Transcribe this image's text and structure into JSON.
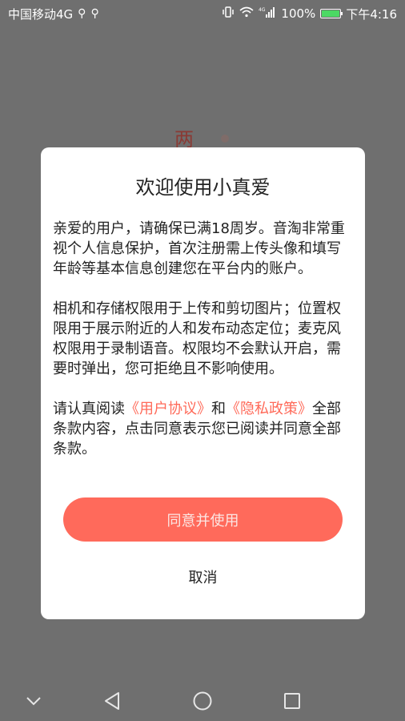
{
  "status_bar": {
    "carrier": "中国移动4G",
    "network": "4G",
    "battery_percent": "100%",
    "time": "下午4:16",
    "battery_level": 1.0,
    "colors": {
      "battery_fill": "#4cd964"
    }
  },
  "background": {
    "partial_char": "两"
  },
  "dialog": {
    "title": "欢迎使用小真爱",
    "paragraph1": "亲爱的用户，请确保已满18周岁。音淘非常重视个人信息保护，首次注册需上传头像和填写年龄等基本信息创建您在平台内的账户。",
    "paragraph2": "相机和存储权限用于上传和剪切图片；位置权限用于展示附近的人和发布动态定位；麦克风权限用于录制语音。权限均不会默认开启，需要时弹出，您可拒绝且不影响使用。",
    "paragraph3_prefix": "请认真阅读",
    "user_agreement": "《用户协议》",
    "paragraph3_and": "和",
    "privacy_policy": "《隐私政策》",
    "paragraph3_suffix": "全部条款内容，点击同意表示您已阅读并同意全部条款。",
    "agree_label": "同意并使用",
    "cancel_label": "取消",
    "colors": {
      "accent": "#ff6a5b",
      "link": "#ff6a59"
    }
  },
  "nav_bar": {
    "icons": [
      "chevron-down-icon",
      "back-triangle-icon",
      "home-circle-icon",
      "recents-square-icon"
    ]
  }
}
